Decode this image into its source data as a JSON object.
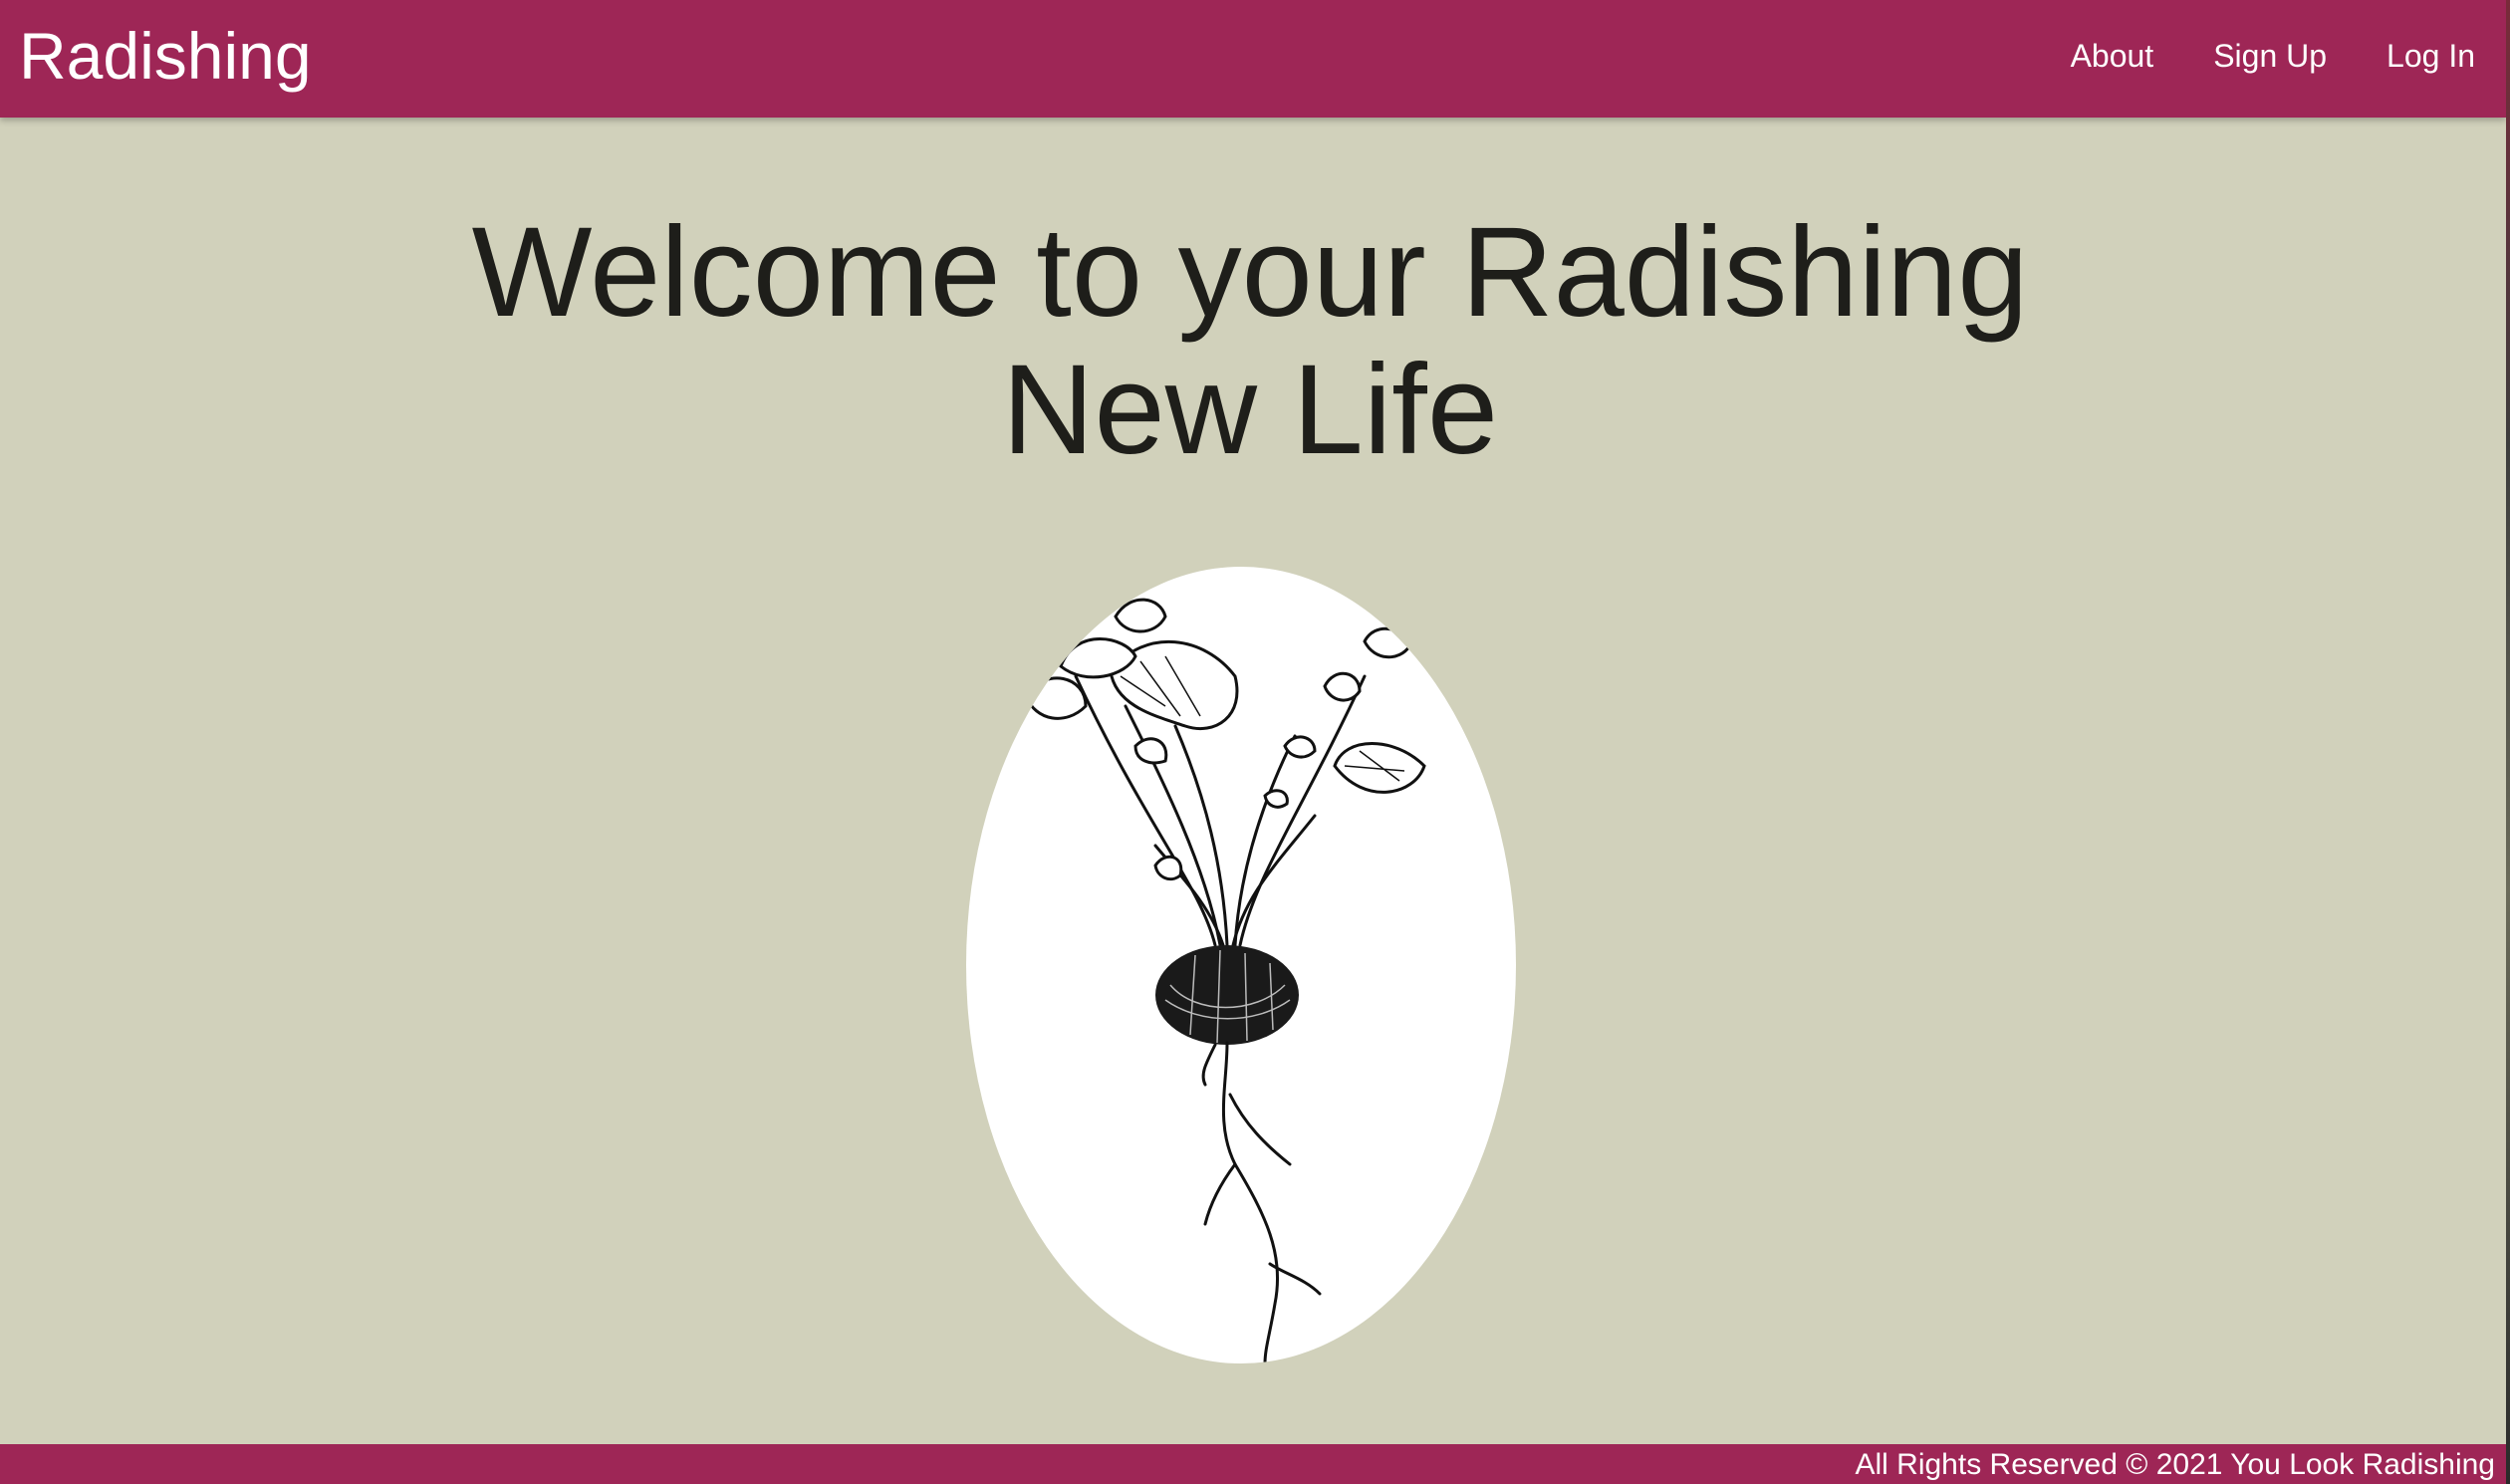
{
  "navbar": {
    "brand": "Radishing",
    "links": [
      "About",
      "Sign Up",
      "Log In"
    ],
    "background": "#9e2656"
  },
  "hero": {
    "title": "Welcome to your Radishing New Life",
    "image_icon": "radish-illustration-icon"
  },
  "footer": {
    "text": "All Rights Reserved © 2021 You Look Radishing"
  },
  "colors": {
    "page_background": "#d1d1bb",
    "accent": "#9e2656",
    "text": "#1e1e1a"
  }
}
